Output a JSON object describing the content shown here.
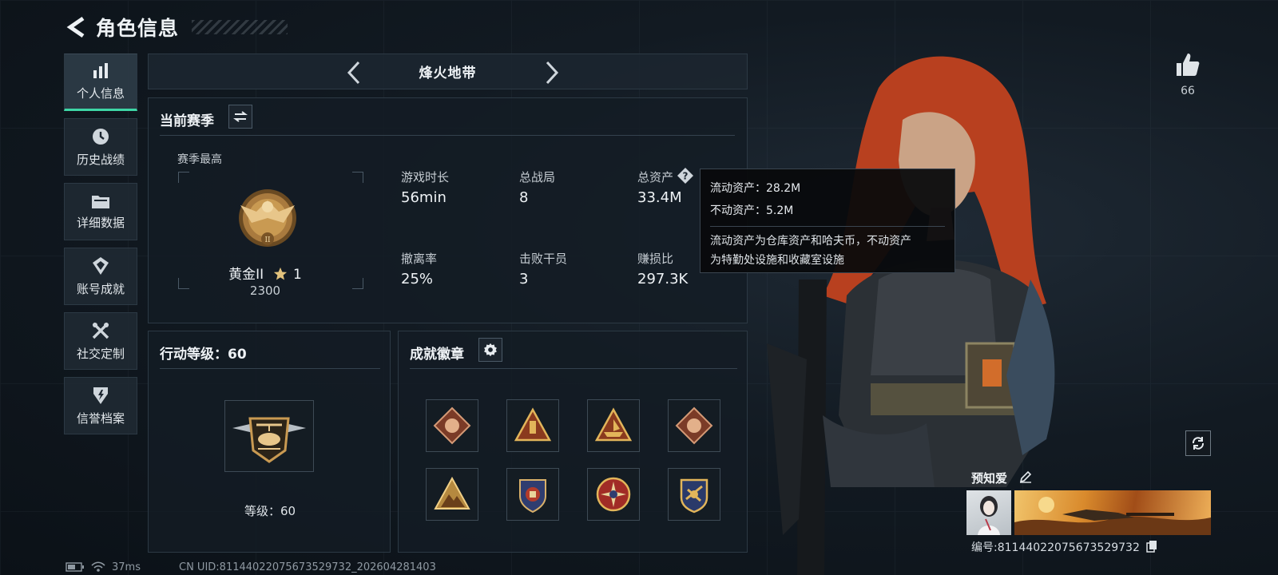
{
  "header": {
    "title": "角色信息"
  },
  "sidebar": {
    "items": [
      {
        "label": "个人信息",
        "icon": "bar-chart-icon"
      },
      {
        "label": "历史战绩",
        "icon": "history-icon"
      },
      {
        "label": "详细数据",
        "icon": "folder-icon"
      },
      {
        "label": "账号成就",
        "icon": "achievement-icon"
      },
      {
        "label": "社交定制",
        "icon": "tools-icon"
      },
      {
        "label": "信誉档案",
        "icon": "reputation-icon"
      }
    ]
  },
  "map_selector": {
    "name": "烽火地带"
  },
  "season": {
    "title": "当前赛季",
    "peak_label": "赛季最高",
    "rank_name": "黄金II",
    "rank_stars": "1",
    "rank_score": "2300",
    "stats": {
      "play_time_label": "游戏时长",
      "play_time_value": "56min",
      "matches_label": "总战局",
      "matches_value": "8",
      "assets_label": "总资产",
      "assets_value": "33.4M",
      "extract_label": "撤离率",
      "extract_value": "25%",
      "kills_label": "击败干员",
      "kills_value": "3",
      "profit_label": "赚损比",
      "profit_value": "297.3K"
    }
  },
  "tooltip": {
    "liquid": "流动资产：28.2M",
    "fixed": "不动资产：5.2M",
    "note_line1": "流动资产为仓库资产和哈夫币，不动资产",
    "note_line2": "为特勤处设施和收藏室设施"
  },
  "action_level": {
    "title": "行动等级：60",
    "level_text": "等级：60"
  },
  "achievements": {
    "title": "成就徽章",
    "badge_count": 8
  },
  "profile": {
    "likes": "66",
    "player_name": "预知爱",
    "player_id": "编号:811440220756735297​32"
  },
  "status_bar": {
    "ping": "37ms",
    "uid": "CN UID:811440220756735297​32_202604281403"
  },
  "colors": {
    "accent": "#3ed6a6",
    "gold": "#c99a52",
    "tooltip_bg": "#08090c"
  }
}
